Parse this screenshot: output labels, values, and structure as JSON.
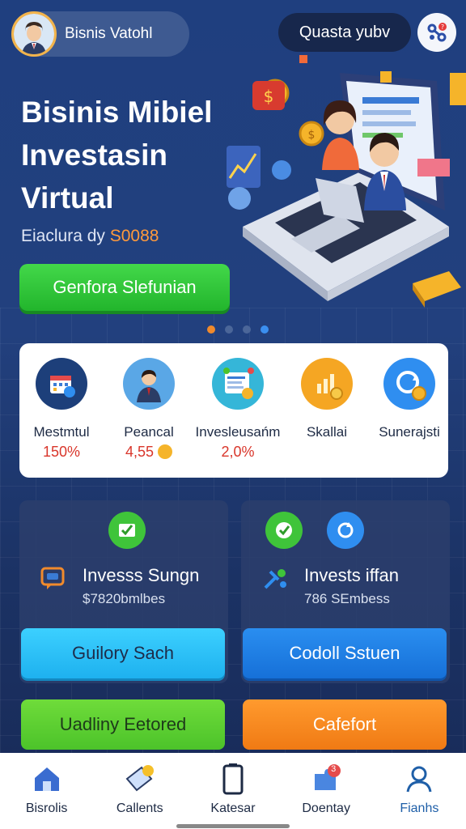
{
  "header": {
    "user_name": "Bisnis Vatohl",
    "search_label": "Quasta yubv"
  },
  "hero": {
    "title_line1": "Bisinis Mibiel",
    "title_line2": "Investasin",
    "title_line3": "Virtual",
    "subtitle_prefix": "Eiaclura dy ",
    "subtitle_amount": "S0088",
    "cta_label": "Genfora Slefunian",
    "carousel_count": 4
  },
  "categories": [
    {
      "label": "Mestmtul",
      "value": "150%",
      "icon": "calendar-icon"
    },
    {
      "label": "Peancal",
      "value": "4,55",
      "icon": "businessman-icon"
    },
    {
      "label": "Invesleusańm",
      "value": "2,0%",
      "icon": "invoice-icon"
    },
    {
      "label": "Skallai",
      "value": "",
      "icon": "chart-coin-icon"
    },
    {
      "label": "Sunerajsti",
      "value": "",
      "icon": "refresh-coin-icon"
    }
  ],
  "panels": [
    {
      "title": "Invesss Sungn",
      "subtitle": "$7820bmlbes",
      "button": "Guilory Sach",
      "badge_icon": "check-icon",
      "title_icon": "chat-icon"
    },
    {
      "title": "Invests iffan",
      "subtitle": "786 SEmbess",
      "button": "Codoll Sstuen",
      "badge_icon": "check-icon",
      "title_icon": "tools-icon"
    }
  ],
  "actions": {
    "green_label": "Uadliny Eetored",
    "orange_label": "Cafefort"
  },
  "nav": [
    {
      "label": "Bisrolis",
      "icon": "home-icon"
    },
    {
      "label": "Callents",
      "icon": "ticket-icon"
    },
    {
      "label": "Katesar",
      "icon": "phone-icon"
    },
    {
      "label": "Doentay",
      "icon": "puzzle-icon",
      "badge": "3"
    },
    {
      "label": "Fianhs",
      "icon": "profile-icon"
    }
  ],
  "colors": {
    "accent_green": "#22b52c",
    "accent_orange": "#f07a14",
    "accent_cyan": "#1eb1ef",
    "value_red": "#d9362b"
  }
}
